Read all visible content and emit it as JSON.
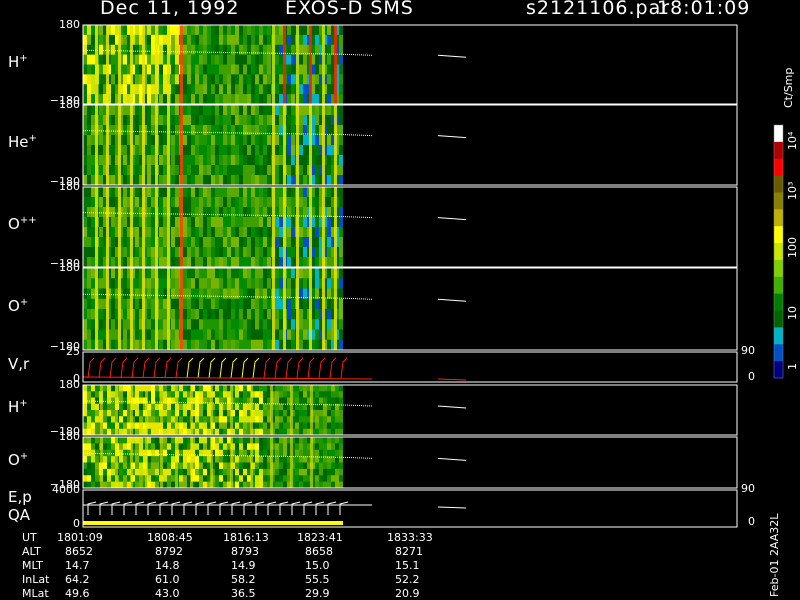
{
  "header": {
    "date": "Dec 11, 1992",
    "instrument": "EXOS-D SMS",
    "file": "s2121106.par",
    "time": "18:01:09"
  },
  "panels": [
    {
      "id": "p1",
      "label": "H",
      "sup": "+",
      "top": "180",
      "bottom": "−180"
    },
    {
      "id": "p2",
      "label": "He",
      "sup": "+",
      "top": "180",
      "bottom": "−180"
    },
    {
      "id": "p3",
      "label": "O",
      "sup": "++",
      "top": "180",
      "bottom": "−180"
    },
    {
      "id": "p4",
      "label": "O",
      "sup": "+",
      "top": "180",
      "bottom": "−180"
    },
    {
      "id": "p5",
      "label": "V,r",
      "sup": "",
      "top": "25",
      "bottom": "0",
      "right_top": "90",
      "right_bottom": "0"
    },
    {
      "id": "p6",
      "label": "H",
      "sup": "+",
      "top": "180",
      "bottom": "−180"
    },
    {
      "id": "p7",
      "label": "O",
      "sup": "+",
      "top": "180",
      "bottom": "−180"
    },
    {
      "id": "p8",
      "label": "E,p",
      "label2": "QA",
      "sup": "",
      "top": "4000",
      "bottom": "0",
      "right_top": "90",
      "right_bottom": "0"
    }
  ],
  "colorbar": {
    "unit": "Ct/Smp",
    "labels": [
      "10⁴",
      "10³",
      "100",
      "10",
      "1"
    ],
    "colors": [
      "#ffffff",
      "#b00000",
      "#ff0000",
      "#6a5a00",
      "#8a8000",
      "#c0b000",
      "#ffff00",
      "#c8e600",
      "#80d000",
      "#40b000",
      "#008000",
      "#006400",
      "#00b4c8",
      "#0050c8",
      "#000080"
    ]
  },
  "footer": {
    "rows": [
      {
        "label": "UT",
        "values": [
          "1801:09",
          "1808:45",
          "1816:13",
          "1823:41",
          "1833:33"
        ]
      },
      {
        "label": "ALT",
        "values": [
          "8652",
          "8792",
          "8793",
          "8658",
          "8271"
        ]
      },
      {
        "label": "MLT",
        "values": [
          "14.7",
          "14.8",
          "14.9",
          "15.0",
          "15.1"
        ]
      },
      {
        "label": "InLat",
        "values": [
          "64.2",
          "61.0",
          "58.2",
          "55.5",
          "52.2"
        ]
      },
      {
        "label": "MLat",
        "values": [
          "49.6",
          "43.0",
          "36.5",
          "29.9",
          "20.9"
        ]
      }
    ],
    "side_text": "Feb-01 2AA32L"
  },
  "chart_data": {
    "type": "heatmap",
    "title": "Dec 11, 1992   EXOS-D SMS",
    "xlabel": "UT",
    "x_ticks": [
      "1801:09",
      "1808:45",
      "1816:13",
      "1823:41",
      "1833:33"
    ],
    "panels": [
      "H+",
      "He+",
      "O++",
      "O+",
      "V,r",
      "H+",
      "O+",
      "E,p / QA"
    ],
    "ylim": [
      -180,
      180
    ],
    "color_scale": "log",
    "color_range": [
      1,
      10000
    ],
    "colorbar_label": "Ct/Smp"
  }
}
